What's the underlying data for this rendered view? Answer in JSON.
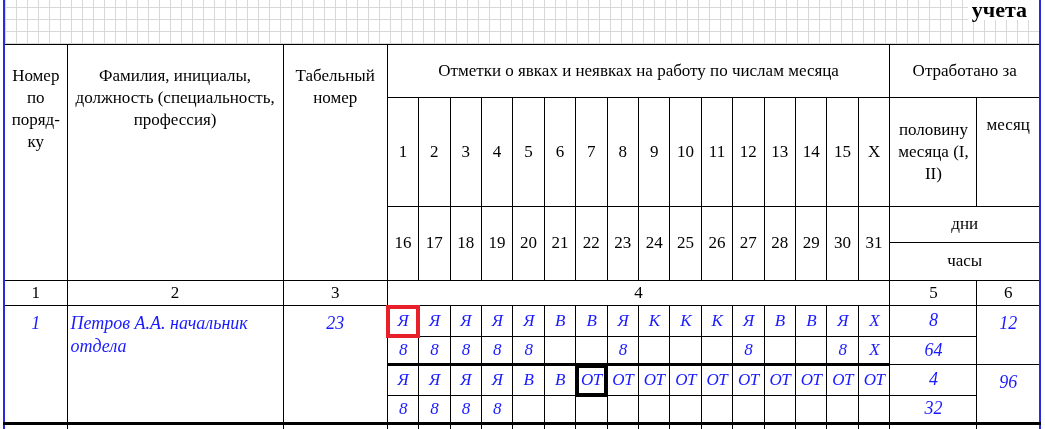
{
  "heading": "учета",
  "header": {
    "col1": "Номер по поряд-ку",
    "col2": "Фамилия, инициалы, должность (специальность, профессия)",
    "col3": "Табельный номер",
    "marks": "Отметки о явках и неявках на работу по числам месяца",
    "worked": "Отработано за",
    "half": "половину месяца (I, II)",
    "month": "месяц",
    "days_label": "дни",
    "hours_label": "часы",
    "days_first": [
      "1",
      "2",
      "3",
      "4",
      "5",
      "6",
      "7",
      "8",
      "9",
      "10",
      "11",
      "12",
      "13",
      "14",
      "15",
      "X"
    ],
    "days_second": [
      "16",
      "17",
      "18",
      "19",
      "20",
      "21",
      "22",
      "23",
      "24",
      "25",
      "26",
      "27",
      "28",
      "29",
      "30",
      "31"
    ]
  },
  "column_numbers": [
    "1",
    "2",
    "3",
    "4",
    "5",
    "6"
  ],
  "rows": [
    {
      "number": "1",
      "name": "Петров А.А. начальник отдела",
      "tab_number": "23",
      "halves": [
        {
          "cells": [
            {
              "mark": "Я",
              "hours": "8",
              "framed": true,
              "color": "#e8202a"
            },
            {
              "mark": "Я",
              "hours": "8",
              "framed": false
            },
            {
              "mark": "Я",
              "hours": "8",
              "framed": false
            },
            {
              "mark": "Я",
              "hours": "8",
              "framed": false
            },
            {
              "mark": "Я",
              "hours": "8",
              "framed": false
            },
            {
              "mark": "В",
              "framed": false
            },
            {
              "mark": "В",
              "framed": false
            },
            {
              "mark": "Я",
              "hours": "8",
              "framed": false
            },
            {
              "mark": "К",
              "framed": false
            },
            {
              "mark": "К",
              "framed": false
            },
            {
              "mark": "К",
              "framed": false
            },
            {
              "mark": "Я",
              "hours": "8",
              "framed": false
            },
            {
              "mark": "В",
              "framed": false
            },
            {
              "mark": "В",
              "framed": false
            },
            {
              "mark": "Я",
              "hours": "8",
              "framed": false
            },
            {
              "mark": "Х",
              "hours": "Х",
              "framed": false
            }
          ],
          "days": "8",
          "hours_total": "64",
          "month": "12"
        },
        {
          "cells": [
            {
              "mark": "Я",
              "hours": "8",
              "framed": false
            },
            {
              "mark": "Я",
              "hours": "8",
              "framed": false
            },
            {
              "mark": "Я",
              "hours": "8",
              "framed": false
            },
            {
              "mark": "Я",
              "hours": "8",
              "framed": false
            },
            {
              "mark": "В",
              "framed": false
            },
            {
              "mark": "В",
              "framed": false
            },
            {
              "mark": "ОТ",
              "framed": true,
              "color": "#000000"
            },
            {
              "mark": "ОТ",
              "framed": false
            },
            {
              "mark": "ОТ",
              "framed": false
            },
            {
              "mark": "ОТ",
              "framed": false
            },
            {
              "mark": "ОТ",
              "framed": false
            },
            {
              "mark": "ОТ",
              "framed": false
            },
            {
              "mark": "ОТ",
              "framed": false
            },
            {
              "mark": "ОТ",
              "framed": false
            },
            {
              "mark": "ОТ",
              "framed": false
            },
            {
              "mark": "ОТ",
              "framed": false
            }
          ],
          "days": "4",
          "hours_total": "32",
          "month": "96"
        }
      ]
    }
  ]
}
